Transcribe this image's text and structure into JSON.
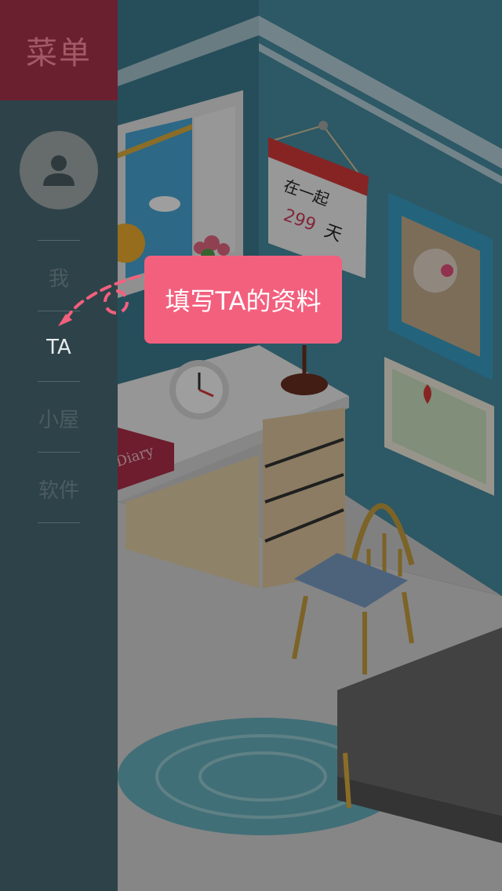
{
  "sidebar": {
    "title": "菜单",
    "items": [
      {
        "label": "我",
        "active": false
      },
      {
        "label": "TA",
        "active": true
      },
      {
        "label": "小屋",
        "active": false
      },
      {
        "label": "软件",
        "active": false
      }
    ]
  },
  "tooltip": {
    "text": "填写TA的资料"
  },
  "scene": {
    "calendar_line1": "在一起",
    "calendar_days": "299",
    "calendar_unit": "天",
    "diary_text": "Diary"
  },
  "colors": {
    "menu_header": "#6b2030",
    "sidebar": "#2e4349",
    "tooltip": "#f3607e"
  }
}
